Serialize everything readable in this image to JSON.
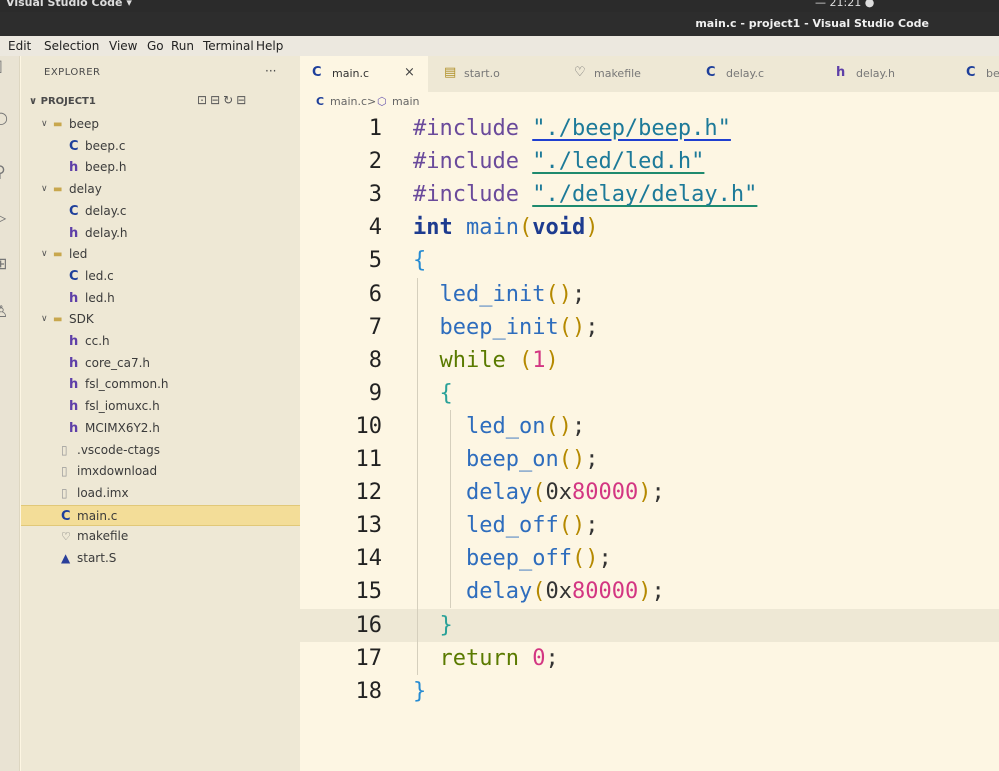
{
  "os": {
    "app_label": "Visual Studio Code ▾",
    "clock": "— 21:21 ●"
  },
  "window": {
    "title": "main.c - project1 - Visual Studio Code"
  },
  "menu": [
    "Edit",
    "Selection",
    "View",
    "Go",
    "Run",
    "Terminal",
    "Help"
  ],
  "sidebar": {
    "header": "EXPLORER",
    "more": "···",
    "project": "PROJECT1",
    "tree": [
      {
        "label": "beep",
        "type": "folder"
      },
      {
        "label": "beep.c",
        "type": "c"
      },
      {
        "label": "beep.h",
        "type": "h"
      },
      {
        "label": "delay",
        "type": "folder"
      },
      {
        "label": "delay.c",
        "type": "c"
      },
      {
        "label": "delay.h",
        "type": "h"
      },
      {
        "label": "led",
        "type": "folder"
      },
      {
        "label": "led.c",
        "type": "c"
      },
      {
        "label": "led.h",
        "type": "h"
      },
      {
        "label": "SDK",
        "type": "folder"
      },
      {
        "label": "cc.h",
        "type": "h"
      },
      {
        "label": "core_ca7.h",
        "type": "h"
      },
      {
        "label": "fsl_common.h",
        "type": "h"
      },
      {
        "label": "fsl_iomuxc.h",
        "type": "h"
      },
      {
        "label": "MCIMX6Y2.h",
        "type": "h"
      },
      {
        "label": ".vscode-ctags",
        "type": "file"
      },
      {
        "label": "imxdownload",
        "type": "file"
      },
      {
        "label": "load.imx",
        "type": "file"
      },
      {
        "label": "main.c",
        "type": "c",
        "selected": true
      },
      {
        "label": "makefile",
        "type": "make"
      },
      {
        "label": "start.S",
        "type": "asm"
      }
    ]
  },
  "tabs": [
    {
      "label": "main.c",
      "icon": "C",
      "active": true,
      "close": "×"
    },
    {
      "label": "start.o",
      "icon": "▤"
    },
    {
      "label": "makefile",
      "icon": "♡"
    },
    {
      "label": "delay.c",
      "icon": "C"
    },
    {
      "label": "delay.h",
      "icon": "h"
    },
    {
      "label": "be",
      "icon": "C"
    }
  ],
  "breadcrumb": {
    "file": "main.c",
    "sep": ">",
    "symbol": "main"
  },
  "editor": {
    "line_numbers": [
      "1",
      "2",
      "3",
      "4",
      "5",
      "6",
      "7",
      "8",
      "9",
      "10",
      "11",
      "12",
      "13",
      "14",
      "15",
      "16",
      "17",
      "18"
    ],
    "current_line": 16,
    "lines": [
      "#include \"./beep/beep.h\"",
      "#include \"./led/led.h\"",
      "#include \"./delay/delay.h\"",
      "int main(void)",
      "{",
      "  led_init();",
      "  beep_init();",
      "  while (1)",
      "  {",
      "    led_on();",
      "    beep_on();",
      "    delay(0x80000);",
      "    led_off();",
      "    beep_off();",
      "    delay(0x80000);",
      "  }",
      "  return 0;",
      "}"
    ]
  }
}
